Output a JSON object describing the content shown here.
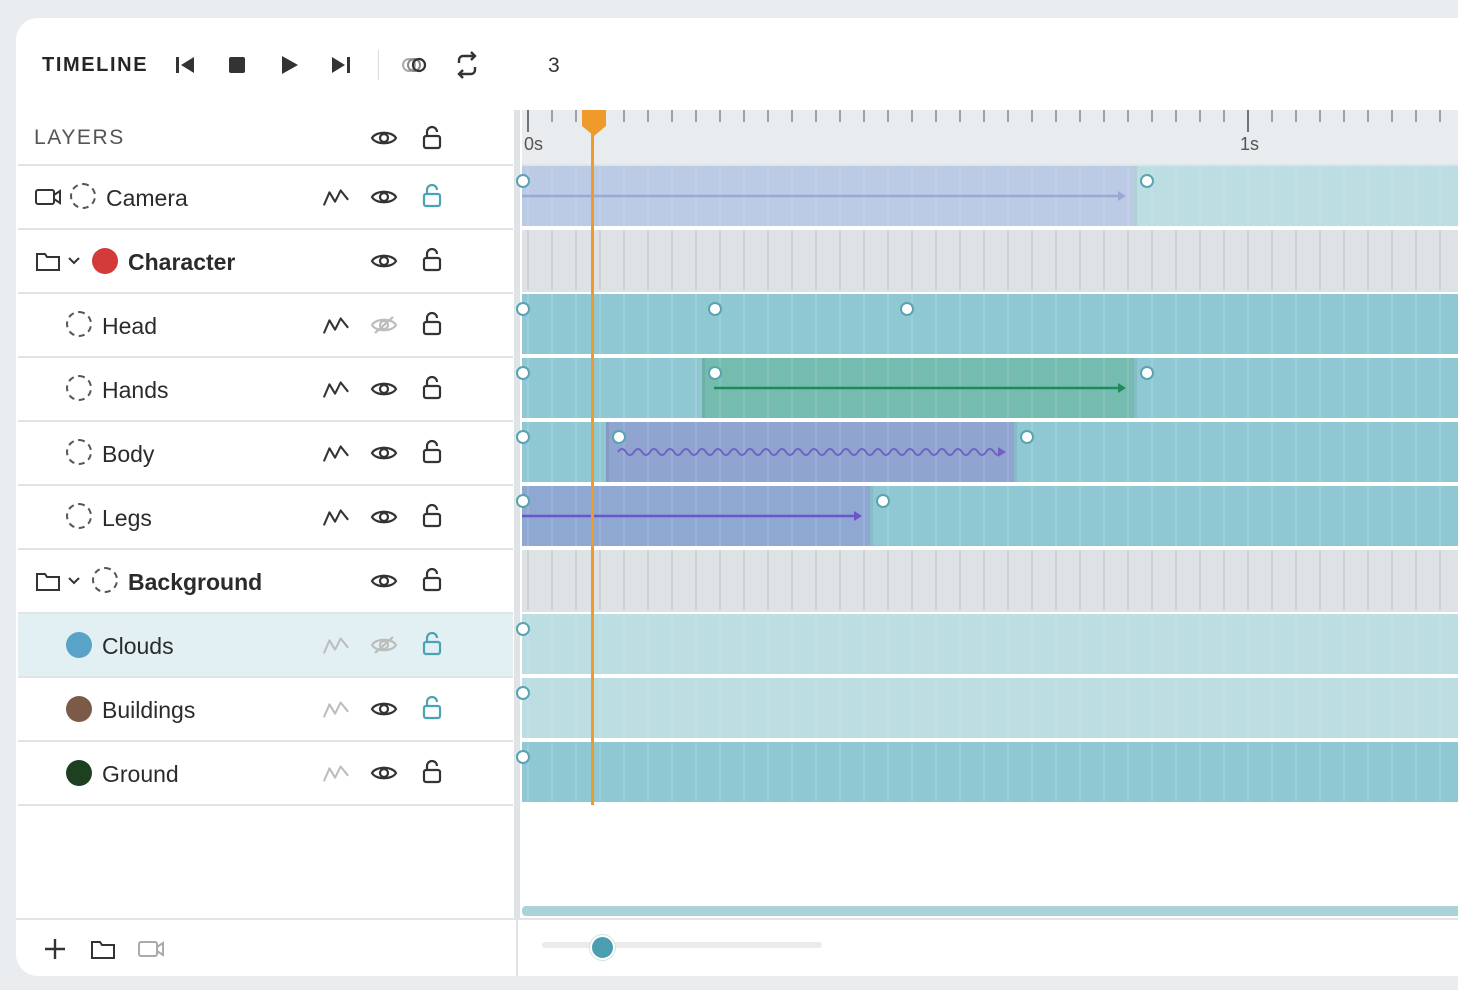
{
  "toolbar": {
    "title": "TIMELINE",
    "frame": "3",
    "buttons": [
      "skip-to-start",
      "stop",
      "play",
      "skip-to-end",
      "onion-skin",
      "loop"
    ]
  },
  "layers": {
    "header": "LAYERS",
    "rows": [
      {
        "name": "Camera",
        "kind": "camera",
        "bold": false,
        "marker": "ring",
        "graph": true,
        "visible": true,
        "locked": false,
        "lock_color": "#4aa3b4"
      },
      {
        "name": "Character",
        "kind": "folder",
        "bold": true,
        "marker": "#d33a3a",
        "graph": false,
        "visible": true,
        "locked": false
      },
      {
        "name": "Head",
        "kind": "child",
        "bold": false,
        "marker": "ring",
        "graph": true,
        "visible": false,
        "locked": false
      },
      {
        "name": "Hands",
        "kind": "child",
        "bold": false,
        "marker": "ring",
        "graph": true,
        "visible": true,
        "locked": false
      },
      {
        "name": "Body",
        "kind": "child",
        "bold": false,
        "marker": "ring",
        "graph": true,
        "visible": true,
        "locked": false
      },
      {
        "name": "Legs",
        "kind": "child",
        "bold": false,
        "marker": "ring",
        "graph": true,
        "visible": true,
        "locked": false
      },
      {
        "name": "Background",
        "kind": "folder",
        "bold": true,
        "marker": "ring",
        "graph": false,
        "visible": true,
        "locked": false
      },
      {
        "name": "Clouds",
        "kind": "child",
        "bold": false,
        "marker": "#5aa3c8",
        "graph": true,
        "graph_dim": true,
        "visible": false,
        "locked": false,
        "lock_color": "#4aa3b4",
        "selected": true
      },
      {
        "name": "Buildings",
        "kind": "child",
        "bold": false,
        "marker": "#7b5a48",
        "graph": true,
        "graph_dim": true,
        "visible": true,
        "locked": false,
        "lock_color": "#4aa3b4"
      },
      {
        "name": "Ground",
        "kind": "child",
        "bold": false,
        "marker": "#1e4020",
        "graph": true,
        "graph_dim": true,
        "visible": true,
        "locked": false
      }
    ]
  },
  "ruler": {
    "labels": [
      "0s",
      "1s"
    ]
  },
  "colors": {
    "accent": "#4b9db0",
    "playhead": "#ef9b2c",
    "teal": "#8fc8d2",
    "teal_light": "#bcdde2",
    "purple": "#8fa5d0",
    "green": "#75bbb0"
  },
  "bottom": {
    "buttons": [
      "add",
      "folder",
      "camera"
    ]
  }
}
